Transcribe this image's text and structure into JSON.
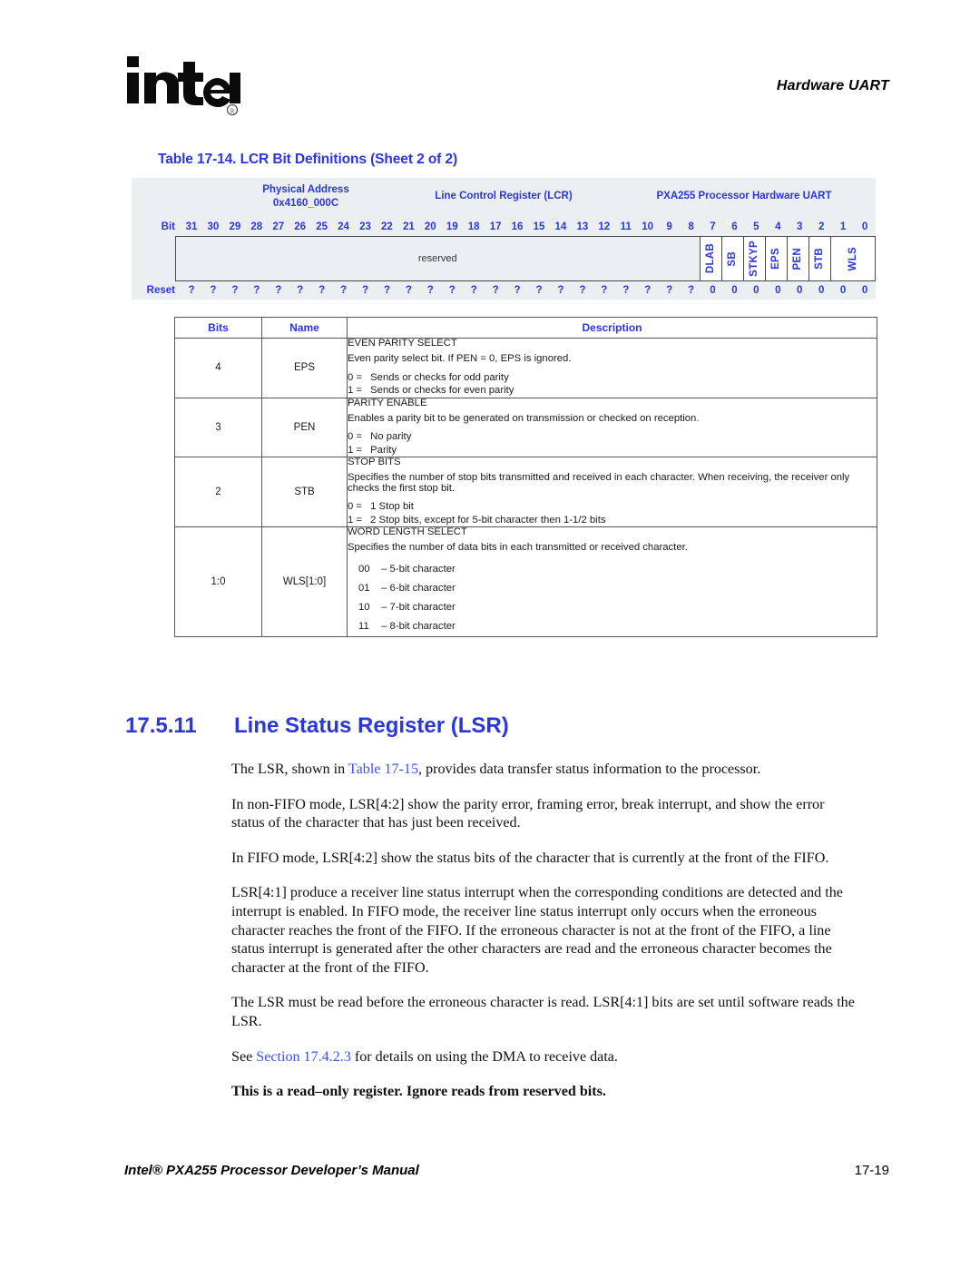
{
  "header": {
    "running_head": "Hardware UART",
    "logo_alt": "intel"
  },
  "table_caption": "Table 17-14. LCR Bit Definitions (Sheet 2 of 2)",
  "register_diagram": {
    "physical_address_label": "Physical Address",
    "physical_address_value": "0x4160_000C",
    "register_name": "Line Control Register (LCR)",
    "processor_label": "PXA255 Processor Hardware UART",
    "bit_row_label": "Bit",
    "reset_row_label": "Reset",
    "bit_numbers": [
      "31",
      "30",
      "29",
      "28",
      "27",
      "26",
      "25",
      "24",
      "23",
      "22",
      "21",
      "20",
      "19",
      "18",
      "17",
      "16",
      "15",
      "14",
      "13",
      "12",
      "11",
      "10",
      "9",
      "8",
      "7",
      "6",
      "5",
      "4",
      "3",
      "2",
      "1",
      "0"
    ],
    "reset_values": [
      "?",
      "?",
      "?",
      "?",
      "?",
      "?",
      "?",
      "?",
      "?",
      "?",
      "?",
      "?",
      "?",
      "?",
      "?",
      "?",
      "?",
      "?",
      "?",
      "?",
      "?",
      "?",
      "?",
      "?",
      "0",
      "0",
      "0",
      "0",
      "0",
      "0",
      "0",
      "0"
    ],
    "fields": [
      {
        "label": "reserved",
        "span": 24,
        "orientation": "horizontal"
      },
      {
        "label": "DLAB",
        "span": 1,
        "orientation": "vertical"
      },
      {
        "label": "SB",
        "span": 1,
        "orientation": "vertical"
      },
      {
        "label": "STKYP",
        "span": 1,
        "orientation": "vertical"
      },
      {
        "label": "EPS",
        "span": 1,
        "orientation": "vertical"
      },
      {
        "label": "PEN",
        "span": 1,
        "orientation": "vertical"
      },
      {
        "label": "STB",
        "span": 1,
        "orientation": "vertical"
      },
      {
        "label": "WLS",
        "span": 2,
        "orientation": "vertical"
      }
    ]
  },
  "desc_table": {
    "headers": [
      "Bits",
      "Name",
      "Description"
    ],
    "rows": [
      {
        "bits": "4",
        "name": "EPS",
        "title": "EVEN PARITY SELECT",
        "detail": "Even parity select bit. If PEN = 0, EPS is ignored.",
        "options": [
          {
            "key": "0 =",
            "text": "Sends or checks for odd parity"
          },
          {
            "key": "1 =",
            "text": "Sends or checks for even parity"
          }
        ]
      },
      {
        "bits": "3",
        "name": "PEN",
        "title": "PARITY ENABLE",
        "detail": "Enables a parity bit to be generated on transmission or checked on reception.",
        "options": [
          {
            "key": "0 =",
            "text": "No parity"
          },
          {
            "key": "1 =",
            "text": "Parity"
          }
        ]
      },
      {
        "bits": "2",
        "name": "STB",
        "title": "STOP BITS",
        "detail": "Specifies the number of stop bits transmitted and received in each character. When receiving, the receiver only checks the first stop bit.",
        "options": [
          {
            "key": "0 =",
            "text": "1 Stop bit"
          },
          {
            "key": "1 =",
            "text": "2 Stop bits, except for 5-bit character then 1-1/2 bits"
          }
        ]
      },
      {
        "bits": "1:0",
        "name": "WLS[1:0]",
        "title": "WORD LENGTH SELECT",
        "detail": "Specifies the number of data bits in each transmitted or received character.",
        "options": [
          {
            "key": "00",
            "text": "– 5-bit character"
          },
          {
            "key": "01",
            "text": "– 6-bit character"
          },
          {
            "key": "10",
            "text": "– 7-bit character"
          },
          {
            "key": "11",
            "text": "– 8-bit character"
          }
        ]
      }
    ]
  },
  "section": {
    "number": "17.5.11",
    "title": "Line Status Register (LSR)",
    "paragraphs": [
      {
        "parts": [
          {
            "text": "The LSR, shown in ",
            "link": false
          },
          {
            "text": "Table 17-15",
            "link": true
          },
          {
            "text": ", provides data transfer status information to the processor.",
            "link": false
          }
        ]
      },
      {
        "parts": [
          {
            "text": "In non-FIFO mode, LSR[4:2] show the parity error, framing error, break interrupt, and show the error status of the character that has just been received.",
            "link": false
          }
        ]
      },
      {
        "parts": [
          {
            "text": "In FIFO mode, LSR[4:2] show the status bits of the character that is currently at the front of the FIFO.",
            "link": false
          }
        ]
      },
      {
        "parts": [
          {
            "text": "LSR[4:1] produce a receiver line status interrupt when the corresponding conditions are detected and the interrupt is enabled. In FIFO mode, the receiver line status interrupt only occurs when the erroneous character reaches the front of the FIFO. If the erroneous character is not at the front of the FIFO, a line status interrupt is generated after the other characters are read and the erroneous character becomes the character at the front of the FIFO.",
            "link": false
          }
        ]
      },
      {
        "parts": [
          {
            "text": "The LSR must be read before the erroneous character is read. LSR[4:1] bits are set until software reads the LSR.",
            "link": false
          }
        ]
      },
      {
        "parts": [
          {
            "text": "See ",
            "link": false
          },
          {
            "text": "Section 17.4.2.3",
            "link": true
          },
          {
            "text": " for details on using the DMA to receive data.",
            "link": false
          }
        ]
      }
    ],
    "note": "This is a read–only register. Ignore reads from reserved bits."
  },
  "footer": {
    "left": "Intel® PXA255 Processor Developer’s Manual",
    "right": "17-19"
  },
  "colors": {
    "accent_blue": "#2b35e0",
    "link_blue": "#3a55e8",
    "reg_bg": "#eceff1",
    "border": "#4a4a4a"
  }
}
